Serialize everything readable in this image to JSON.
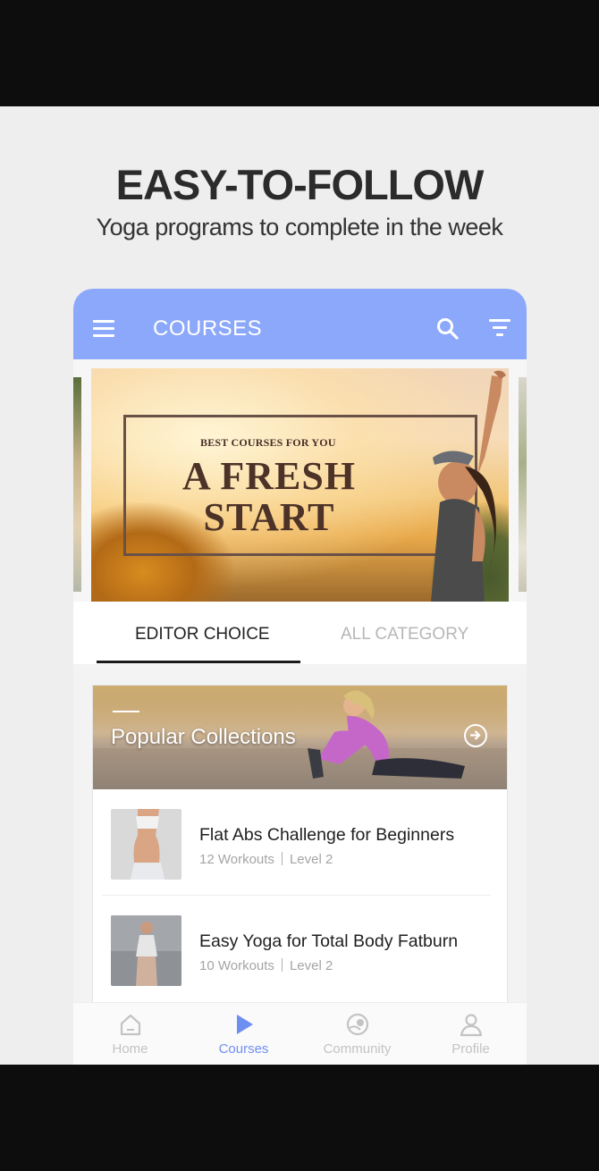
{
  "promo": {
    "headline": "EASY-TO-FOLLOW",
    "subline": "Yoga programs to complete in the week"
  },
  "appbar": {
    "title": "COURSES",
    "color": "#8ca8fa"
  },
  "banner": {
    "kicker": "BEST COURSES FOR YOU",
    "title_line1": "A FRESH",
    "title_line2": "START"
  },
  "tabs": [
    {
      "label": "EDITOR CHOICE",
      "active": true
    },
    {
      "label": "ALL CATEGORY",
      "active": false
    }
  ],
  "collection": {
    "title": "Popular Collections"
  },
  "courses": [
    {
      "title": "Flat Abs Challenge for Beginners",
      "workouts": "12 Workouts",
      "level": "Level 2"
    },
    {
      "title": "Easy Yoga for Total Body Fatburn",
      "workouts": "10 Workouts",
      "level": "Level 2"
    }
  ],
  "bottom_nav": [
    {
      "label": "Home",
      "icon": "home-icon",
      "active": false
    },
    {
      "label": "Courses",
      "icon": "play-icon",
      "active": true
    },
    {
      "label": "Community",
      "icon": "community-icon",
      "active": false
    },
    {
      "label": "Profile",
      "icon": "profile-icon",
      "active": false
    }
  ],
  "accent_color": "#6f8ef2"
}
